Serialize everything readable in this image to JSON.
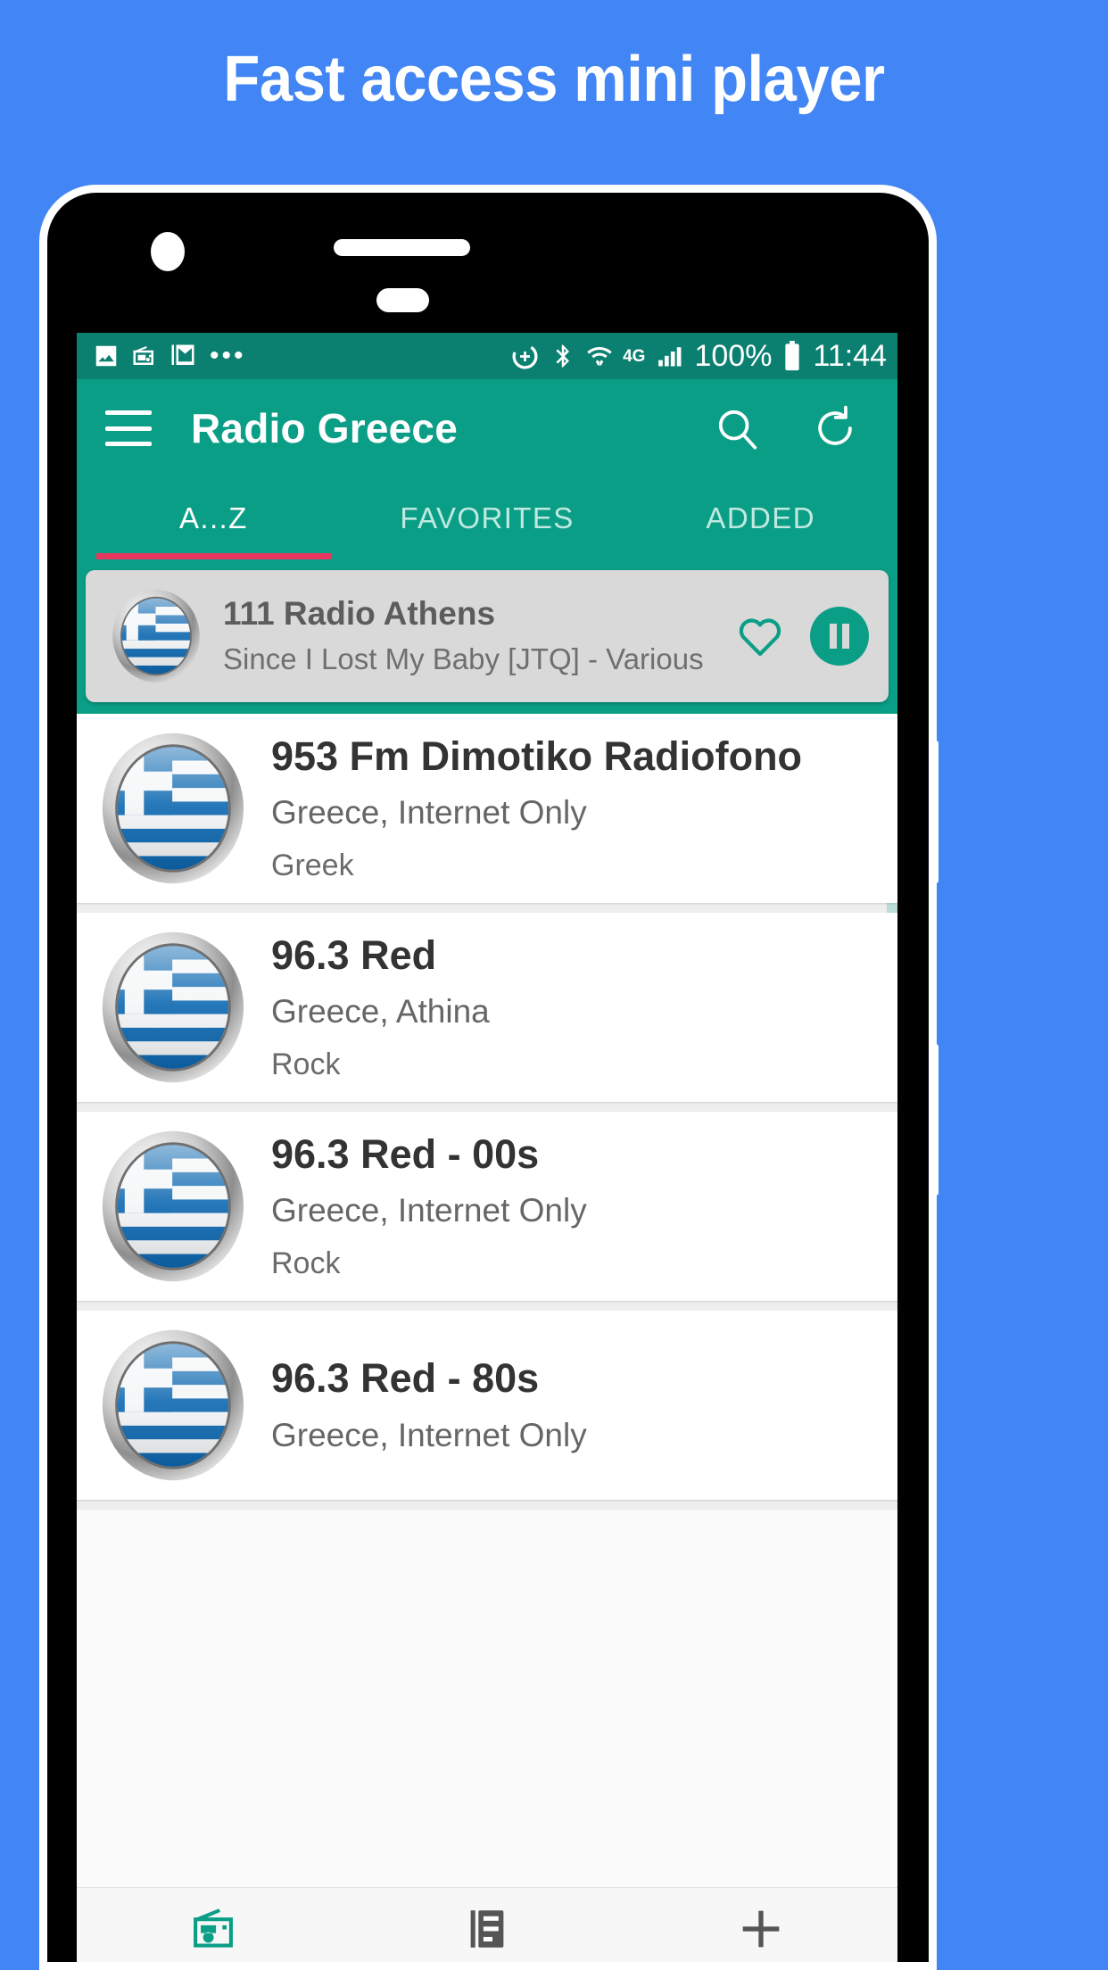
{
  "promo": {
    "headline": "Fast access mini player",
    "background_color": "#4285f4"
  },
  "theme": {
    "primary": "#0b9e86",
    "status_bar": "#0c8070",
    "accent_indicator": "#e8365f",
    "list_background": "#eeeeee",
    "card_background": "#ffffff"
  },
  "status_bar": {
    "icons_left": [
      "image-icon",
      "radio-icon",
      "gmail-icon",
      "more-dots-icon"
    ],
    "icons_right": [
      "do-not-disturb-icon",
      "bluetooth-icon",
      "wifi-icon",
      "4g-icon",
      "signal-icon"
    ],
    "network_label": "4G",
    "battery_percent": "100%",
    "time": "11:44"
  },
  "app_bar": {
    "menu_icon": "hamburger-menu-icon",
    "title": "Radio Greece",
    "search_icon": "search-icon",
    "refresh_icon": "refresh-icon"
  },
  "tabs": {
    "items": [
      {
        "label": "A...Z",
        "active": true
      },
      {
        "label": "FAVORITES",
        "active": false
      },
      {
        "label": "ADDED",
        "active": false
      }
    ]
  },
  "mini_player": {
    "logo": "greece-flag-icon",
    "station": "111 Radio Athens",
    "now_playing": "Since I Lost My Baby [JTQ] - Various",
    "favorite_icon": "heart-outline-icon",
    "play_state_icon": "pause-icon"
  },
  "station_list": [
    {
      "logo": "greece-flag-icon",
      "name": "953 Fm Dimotiko Radiofono",
      "location": "Greece, Internet Only",
      "genre": "Greek"
    },
    {
      "logo": "greece-flag-icon",
      "name": "96.3 Red",
      "location": "Greece, Athina",
      "genre": "Rock"
    },
    {
      "logo": "greece-flag-icon",
      "name": "96.3 Red - 00s",
      "location": "Greece, Internet Only",
      "genre": "Rock"
    },
    {
      "logo": "greece-flag-icon",
      "name": "96.3 Red - 80s",
      "location": "Greece, Internet Only",
      "genre": ""
    }
  ],
  "bottom_nav": {
    "items": [
      {
        "icon": "radio-icon",
        "active": true
      },
      {
        "icon": "playlist-icon",
        "active": false
      },
      {
        "icon": "plus-icon",
        "active": false
      }
    ]
  }
}
